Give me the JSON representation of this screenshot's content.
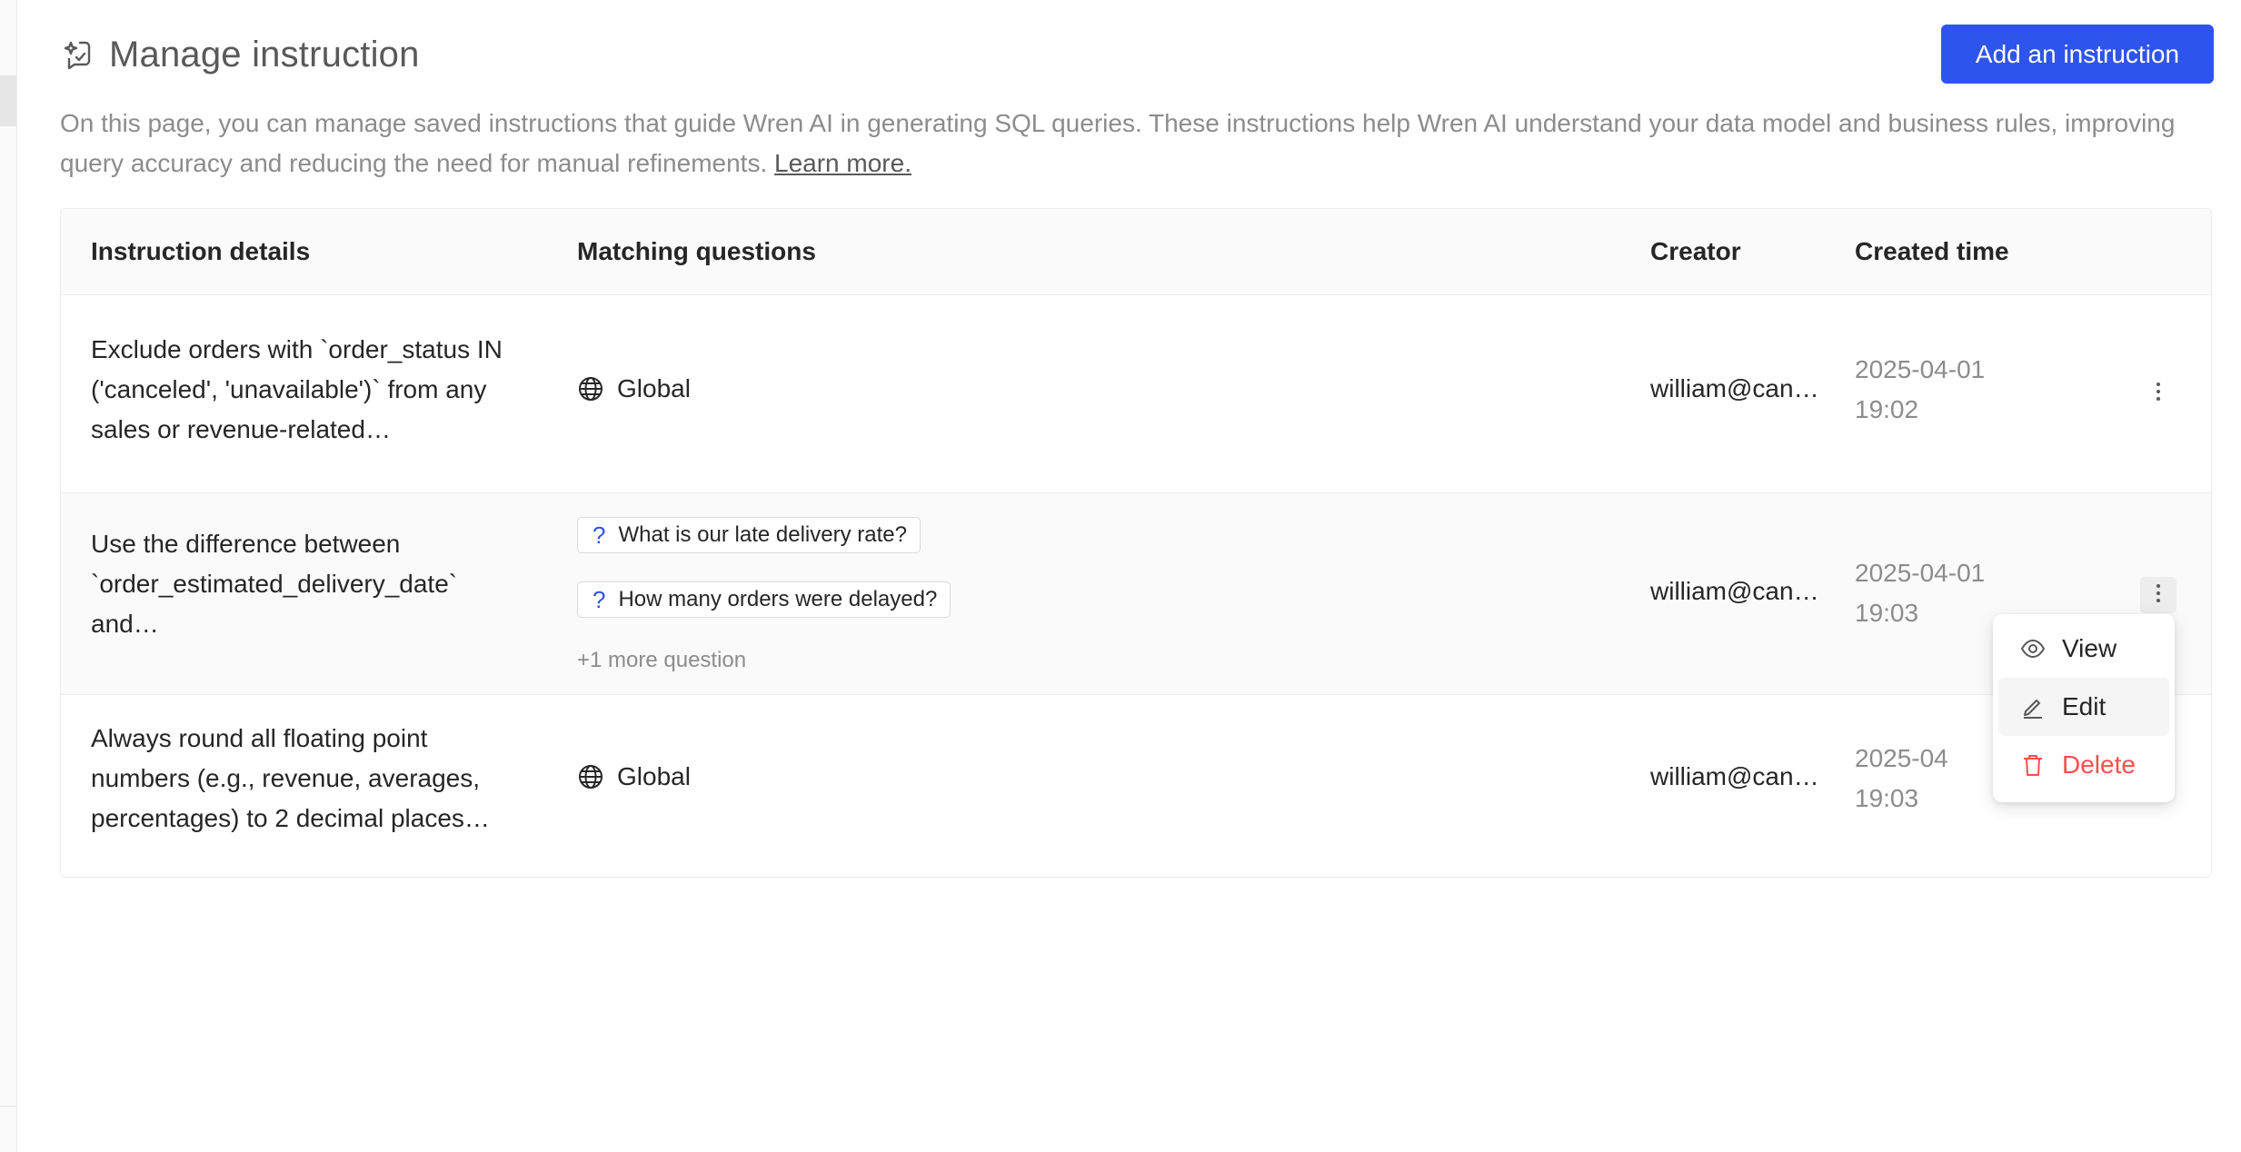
{
  "header": {
    "title": "Manage instruction",
    "title_icon": "instruction-sparkle-icon",
    "add_button_label": "Add an instruction"
  },
  "intro": {
    "text": "On this page, you can manage saved instructions that guide Wren AI in generating SQL queries. These instructions help Wren AI understand your data model and business rules, improving query accuracy and reducing the need for manual refinements.",
    "link_text": "Learn more."
  },
  "table": {
    "columns": [
      "Instruction details",
      "Matching questions",
      "Creator",
      "Created time"
    ],
    "rows": [
      {
        "details": "Exclude orders with `order_status IN ('canceled', 'unavailable')` from any sales or revenue-related…",
        "scope": "Global",
        "questions": [],
        "more": "",
        "creator": "william@can…",
        "date": "2025-04-01",
        "time": "19:02"
      },
      {
        "details": "Use the difference between `order_estimated_delivery_date` and…",
        "scope": "",
        "questions": [
          "What is our late delivery rate?",
          "How many orders were delayed?"
        ],
        "more": "+1 more question",
        "creator": "william@can…",
        "date": "2025-04-01",
        "time": "19:03"
      },
      {
        "details": "Always round all floating point numbers (e.g., revenue, averages, percentages) to 2 decimal places…",
        "scope": "Global",
        "questions": [],
        "more": "",
        "creator": "william@can…",
        "date": "2025-04",
        "time": "19:03"
      }
    ]
  },
  "menu": {
    "items": [
      {
        "label": "View",
        "icon": "eye-icon"
      },
      {
        "label": "Edit",
        "icon": "pencil-icon"
      },
      {
        "label": "Delete",
        "icon": "trash-icon"
      }
    ]
  },
  "colors": {
    "primary": "#2f54eb",
    "danger": "#ff4d4f",
    "muted_text": "#8c8c8c"
  }
}
